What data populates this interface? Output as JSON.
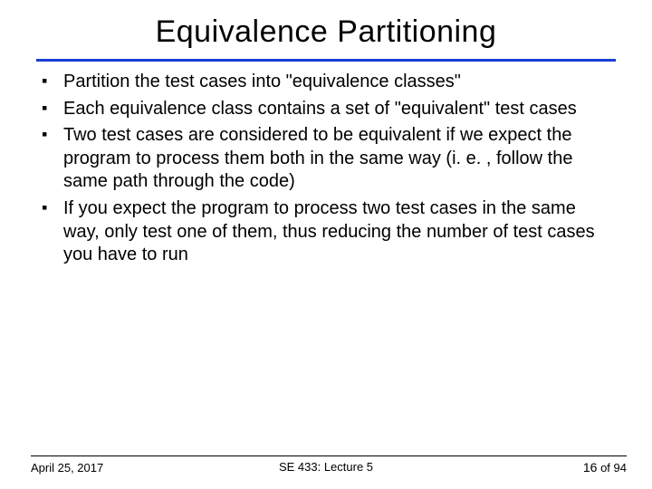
{
  "title": "Equivalence Partitioning",
  "bullets": [
    "Partition the test cases into \"equivalence classes\"",
    "Each equivalence class contains a set of \"equivalent\" test cases",
    "Two test cases are considered to be equivalent if we expect the program to process them both in the same way (i. e. , follow the same path through the code)",
    "If you expect the program to process two test cases in the same way, only test one of them, thus reducing the number of test cases you have to run"
  ],
  "footer": {
    "date": "April 25, 2017",
    "course": "SE 433: Lecture 5",
    "page_current": "16",
    "page_total": "94",
    "page_sep": " of "
  }
}
